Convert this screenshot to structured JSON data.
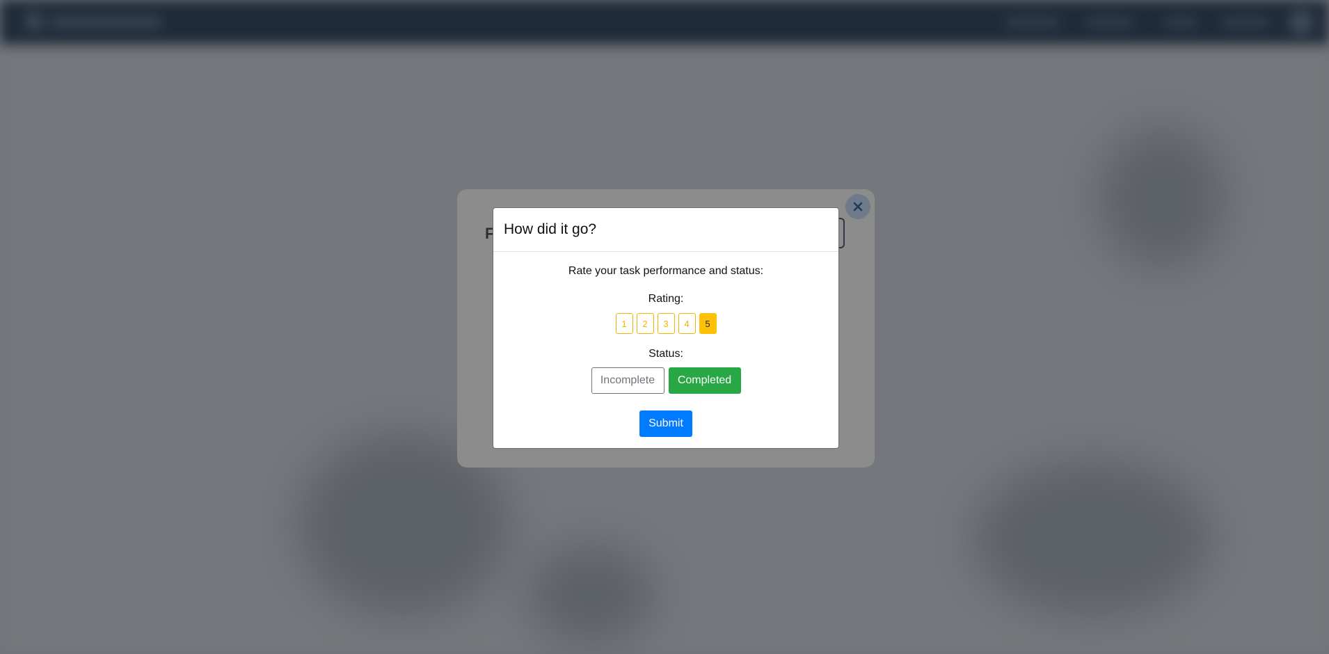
{
  "colors": {
    "rating_accent": "#ffc107",
    "completed": "#28a745",
    "submit": "#007bff",
    "incomplete_outline": "#6c757d",
    "navbar": "#1f2a38"
  },
  "outer_dialog": {
    "title_fragment": "F",
    "close_icon": "close-icon"
  },
  "modal": {
    "title": "How did it go?",
    "prompt": "Rate your task performance and status:",
    "rating": {
      "label": "Rating:",
      "options": [
        "1",
        "2",
        "3",
        "4",
        "5"
      ],
      "selected": "5"
    },
    "status": {
      "label": "Status:",
      "options": [
        "Incomplete",
        "Completed"
      ],
      "selected": "Completed"
    },
    "submit_label": "Submit"
  }
}
